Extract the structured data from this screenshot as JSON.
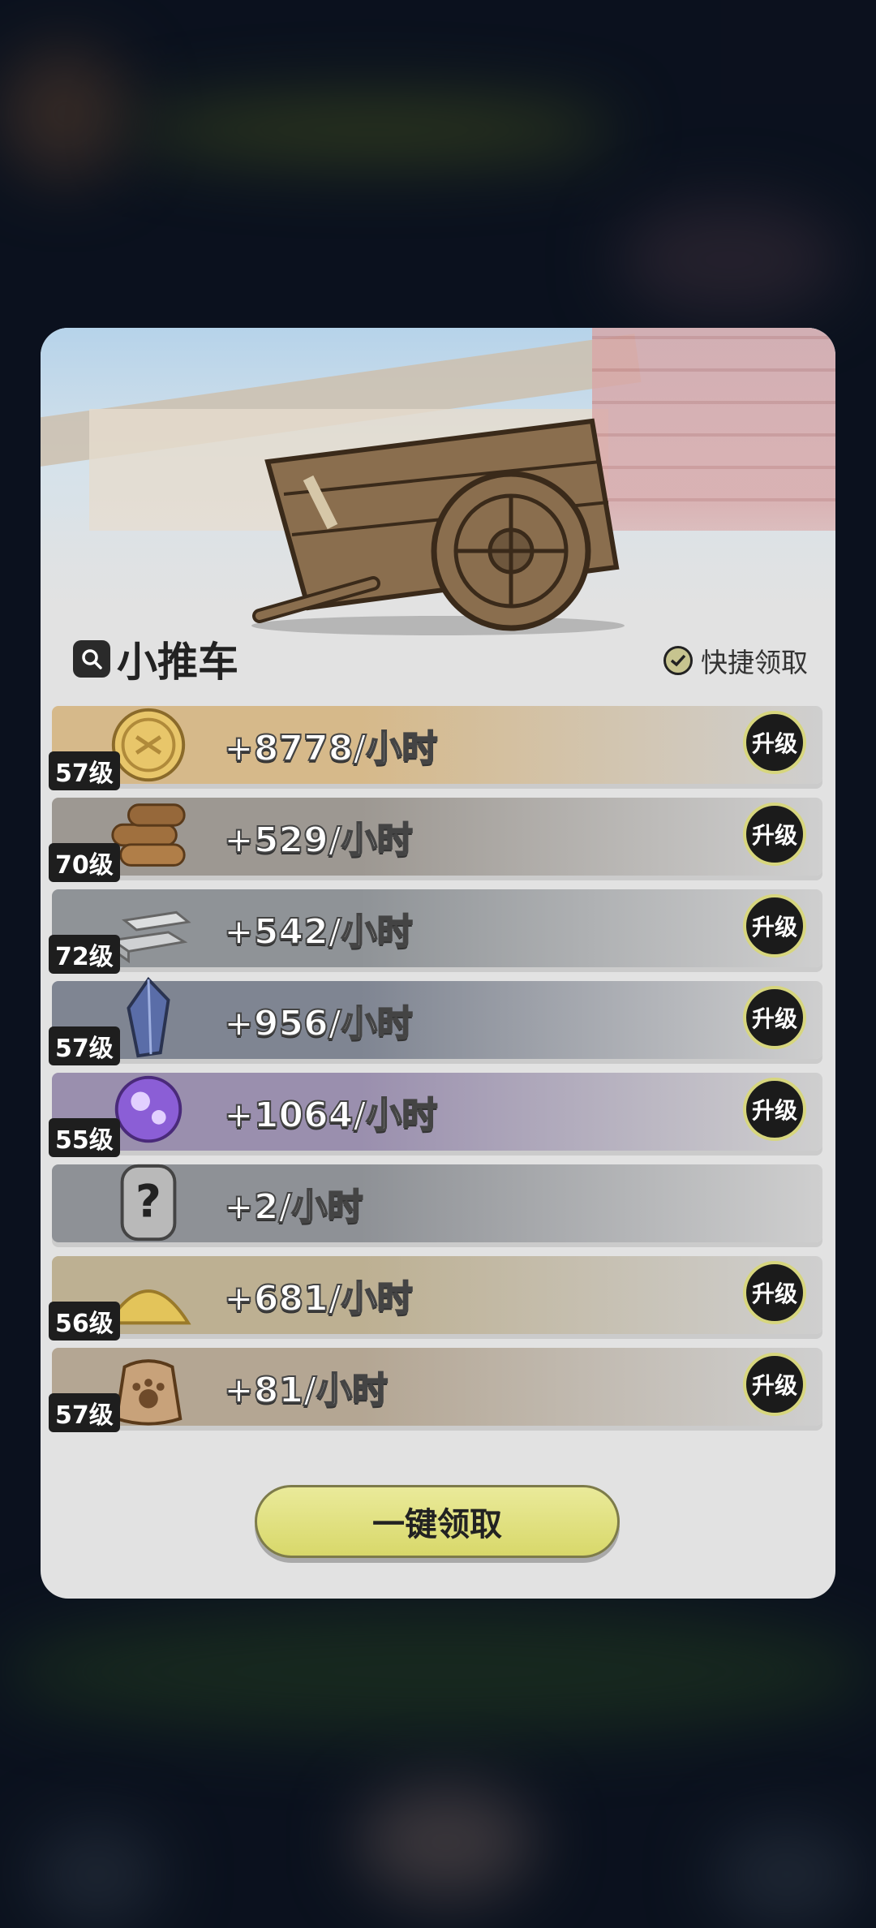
{
  "panel": {
    "title": "小推车",
    "quick_claim_label": "快捷领取",
    "claim_all_label": "一键领取"
  },
  "upgrade_label": "升级",
  "resources": [
    {
      "name": "gold-coin",
      "level": "57级",
      "rate": "+8778/小时",
      "upgradable": true,
      "color": "#d6b98a"
    },
    {
      "name": "wood",
      "level": "70级",
      "rate": "+529/小时",
      "upgradable": true,
      "color": "#9d9892"
    },
    {
      "name": "iron-ingot",
      "level": "72级",
      "rate": "+542/小时",
      "upgradable": true,
      "color": "#8f9397"
    },
    {
      "name": "crystal",
      "level": "57级",
      "rate": "+956/小时",
      "upgradable": true,
      "color": "#7f8592"
    },
    {
      "name": "magic-orb",
      "level": "55级",
      "rate": "+1064/小时",
      "upgradable": true,
      "color": "#9a8fae"
    },
    {
      "name": "mystery-item",
      "level": "",
      "rate": "+2/小时",
      "upgradable": false,
      "color": "#8e9196"
    },
    {
      "name": "sand",
      "level": "56级",
      "rate": "+681/小时",
      "upgradable": true,
      "color": "#bdb092"
    },
    {
      "name": "paw-bag",
      "level": "57级",
      "rate": "+81/小时",
      "upgradable": true,
      "color": "#b4a693"
    }
  ]
}
